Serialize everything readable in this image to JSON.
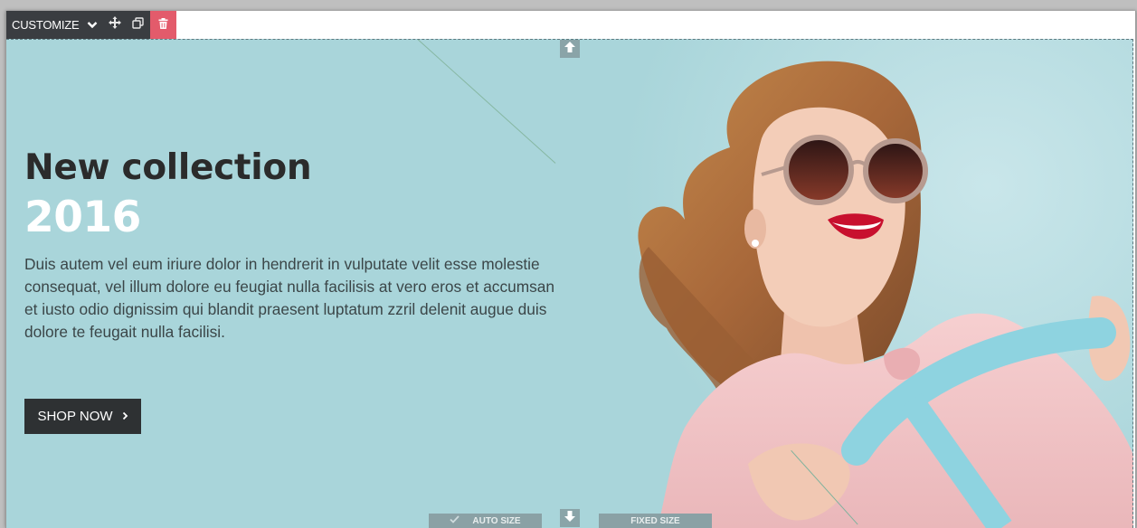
{
  "toolbar": {
    "customize_label": "CUSTOMIZE",
    "icons": [
      "chevron-down-icon",
      "move-icon",
      "duplicate-icon",
      "trash-icon"
    ]
  },
  "slide": {
    "headline": "New collection",
    "year": "2016",
    "description": "Duis autem vel eum iriure dolor in hendrerit in vulputate velit esse molestie consequat, vel illum dolore eu feugiat nulla facilisis at vero eros et accumsan et iusto odio dignissim qui blandit praesent luptatum zzril delenit augue duis dolore te feugait nulla facilisi.",
    "cta_label": "SHOP NOW",
    "background_color": "#a9d5da"
  },
  "size_controls": {
    "auto_label": "AUTO SIZE",
    "fixed_label": "FIXED SIZE"
  },
  "colors": {
    "toolbar_bg": "#3a3d41",
    "delete_bg": "#e35b6b",
    "button_bg": "#2e3133"
  }
}
